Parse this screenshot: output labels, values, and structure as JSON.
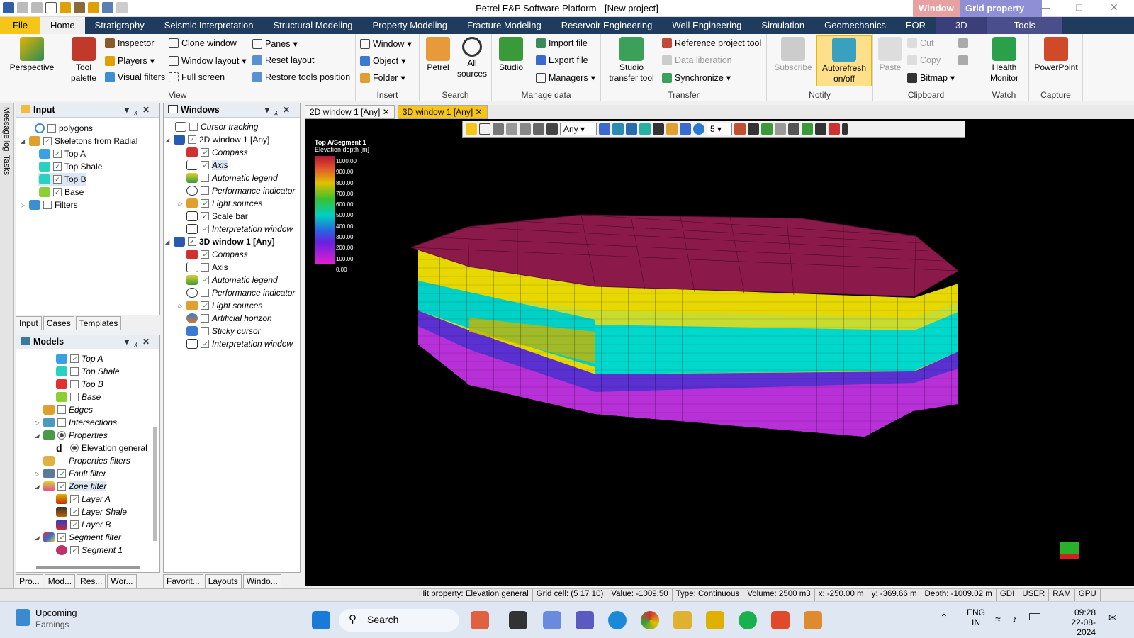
{
  "window": {
    "title": "Petrel E&P Software Platform - [New project]",
    "ctx_window": "Window",
    "ctx_grid": "Grid property"
  },
  "ribbon_tabs": [
    "File",
    "Home",
    "Stratigraphy",
    "Seismic Interpretation",
    "Structural Modeling",
    "Property Modeling",
    "Fracture Modeling",
    "Reservoir Engineering",
    "Well Engineering",
    "Simulation",
    "Geomechanics",
    "EOR",
    "3D",
    "Tools"
  ],
  "ribbon": {
    "view": {
      "label": "View",
      "perspective": "Perspective",
      "tool_palette_1": "Tool",
      "tool_palette_2": "palette",
      "inspector": "Inspector",
      "players": "Players",
      "visual_filters": "Visual filters",
      "clone_window": "Clone window",
      "window_layout": "Window layout",
      "full_screen": "Full screen",
      "panes": "Panes",
      "reset_layout": "Reset layout",
      "restore_tools": "Restore tools position"
    },
    "insert": {
      "label": "Insert",
      "window": "Window",
      "object": "Object",
      "folder": "Folder"
    },
    "search": {
      "label": "Search",
      "petrel": "Petrel",
      "all_1": "All",
      "all_2": "sources"
    },
    "manage": {
      "label": "Manage data",
      "studio": "Studio",
      "import": "Import file",
      "export": "Export file",
      "managers": "Managers"
    },
    "transfer": {
      "label": "Transfer",
      "studio_1": "Studio",
      "studio_2": "transfer tool",
      "ref_tool": "Reference project tool",
      "data_lib": "Data liberation",
      "sync": "Synchronize"
    },
    "notify": {
      "label": "Notify",
      "subscribe": "Subscribe",
      "auto_1": "Autorefresh",
      "auto_2": "on/off"
    },
    "clipboard": {
      "label": "Clipboard",
      "paste": "Paste",
      "cut": "Cut",
      "copy": "Copy",
      "bitmap": "Bitmap"
    },
    "watch": {
      "label": "Watch",
      "health_1": "Health",
      "health_2": "Monitor"
    },
    "capture": {
      "label": "Capture",
      "ppt": "PowerPoint"
    }
  },
  "side_strip": [
    "Message log",
    "Tasks"
  ],
  "input_panel": {
    "title": "Input",
    "items": [
      "polygons",
      "Skeletons from Radial",
      "Top A",
      "Top Shale",
      "Top B",
      "Base",
      "Filters"
    ],
    "tabs": [
      "Input",
      "Cases",
      "Templates"
    ]
  },
  "models_panel": {
    "title": "Models",
    "items": [
      "Top A",
      "Top Shale",
      "Top B",
      "Base",
      "Edges",
      "Intersections",
      "Properties",
      "Elevation general",
      "Properties filters",
      "Fault filter",
      "Zone filter",
      "Layer A",
      "Layer Shale",
      "Layer B",
      "Segment filter",
      "Segment 1"
    ],
    "tabs": [
      "Pro...",
      "Mod...",
      "Res...",
      "Wor..."
    ]
  },
  "windows_panel": {
    "title": "Windows",
    "items": [
      "Cursor tracking",
      "2D window 1 [Any]",
      "Compass",
      "Axis",
      "Automatic legend",
      "Performance indicator",
      "Light sources",
      "Scale bar",
      "Interpretation window",
      "3D window 1 [Any]",
      "Compass",
      "Axis",
      "Automatic legend",
      "Performance indicator",
      "Light sources",
      "Artificial horizon",
      "Sticky cursor",
      "Interpretation window"
    ],
    "tabs": [
      "Favorit...",
      "Layouts",
      "Windo..."
    ]
  },
  "view_tabs": [
    "2D window 1 [Any]",
    "3D window 1 [Any]"
  ],
  "view_toolbar": {
    "domain": "Any",
    "level": "5"
  },
  "legend": {
    "title": "Top A/Segment 1",
    "subtitle": "Elevation depth [m]",
    "ticks": [
      "1000.00",
      "900.00",
      "800.00",
      "700.00",
      "600.00",
      "500.00",
      "400.00",
      "300.00",
      "200.00",
      "100.00",
      "0.00"
    ]
  },
  "status": [
    "Hit property: Elevation general",
    "Grid cell: (5 17 10)",
    "Value: -1009.50",
    "Type: Continuous",
    "Volume: 2500 m3",
    "x: -250.00 m",
    "y: -369.66 m",
    "Depth: -1009.02 m",
    "GDI",
    "USER",
    "RAM",
    "GPU"
  ],
  "taskbar": {
    "widget_title": "Upcoming",
    "widget_sub": "Earnings",
    "search": "Search",
    "lang_1": "ENG",
    "lang_2": "IN",
    "time": "09:28",
    "date": "22-08-2024"
  },
  "colors": {
    "ribbon_dark": "#1f3b5e",
    "accent": "#f5c518",
    "grid_top": "#8b1a4a",
    "cyan": "#00d2c8"
  }
}
